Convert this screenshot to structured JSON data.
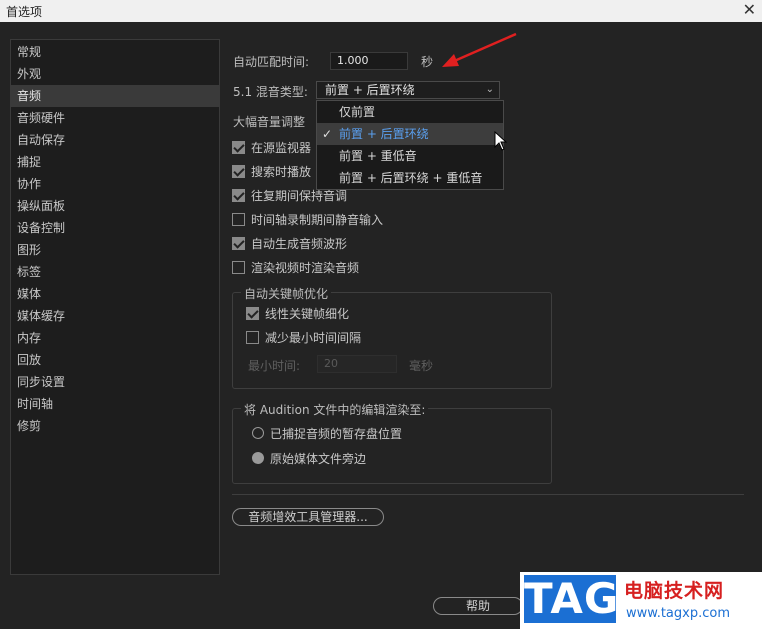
{
  "window": {
    "title": "首选项",
    "close_glyph": "✕"
  },
  "sidebar": {
    "items": [
      {
        "label": "常规"
      },
      {
        "label": "外观"
      },
      {
        "label": "音频",
        "selected": true
      },
      {
        "label": "音频硬件"
      },
      {
        "label": "自动保存"
      },
      {
        "label": "捕捉"
      },
      {
        "label": "协作"
      },
      {
        "label": "操纵面板"
      },
      {
        "label": "设备控制"
      },
      {
        "label": "图形"
      },
      {
        "label": "标签"
      },
      {
        "label": "媒体"
      },
      {
        "label": "媒体缓存"
      },
      {
        "label": "内存"
      },
      {
        "label": "回放"
      },
      {
        "label": "同步设置"
      },
      {
        "label": "时间轴"
      },
      {
        "label": "修剪"
      }
    ]
  },
  "audio": {
    "auto_match_label": "自动匹配时间:",
    "auto_match_value": "1.000",
    "auto_match_unit": "秒",
    "mix_type_label": "5.1 混音类型:",
    "mix_type_value": "前置 + 后置环绕",
    "large_volume_label": "大幅音量调整",
    "checkboxes": [
      {
        "label": "在源监视器",
        "checked": true
      },
      {
        "label": "搜索时播放",
        "checked": true
      },
      {
        "label": "往复期间保持音调",
        "checked": true
      },
      {
        "label": "时间轴录制期间静音输入",
        "checked": false
      },
      {
        "label": "自动生成音频波形",
        "checked": true
      },
      {
        "label": "渲染视频时渲染音频",
        "checked": false
      }
    ]
  },
  "dropdown": {
    "options": [
      {
        "label": "仅前置",
        "selected": false
      },
      {
        "label": "前置 + 后置环绕",
        "selected": true
      },
      {
        "label": "前置 + 重低音",
        "selected": false
      },
      {
        "label": "前置 + 后置环绕 + 重低音",
        "selected": false
      }
    ],
    "check_glyph": "✓"
  },
  "keyframe_group": {
    "title": "自动关键帧优化",
    "linear_label": "线性关键帧细化",
    "linear_checked": true,
    "reduce_label": "减少最小时间间隔",
    "reduce_checked": false,
    "min_time_label": "最小时间:",
    "min_time_value": "20",
    "min_time_unit": "毫秒"
  },
  "render_group": {
    "title": "将 Audition 文件中的编辑渲染至:",
    "options": [
      {
        "label": "已捕捉音频的暂存盘位置",
        "selected": false
      },
      {
        "label": "原始媒体文件旁边",
        "selected": true
      }
    ]
  },
  "buttons": {
    "plugin_manager": "音频增效工具管理器...",
    "help": "帮助"
  },
  "watermark": {
    "logo_text": "TAG",
    "title": "电脑技术网",
    "url": "www.tagxp.com"
  },
  "colors": {
    "accent_blue": "#5aa0f0",
    "annotation_red": "#e02020",
    "watermark_blue": "#1b6fd3",
    "watermark_red": "#d62020"
  }
}
